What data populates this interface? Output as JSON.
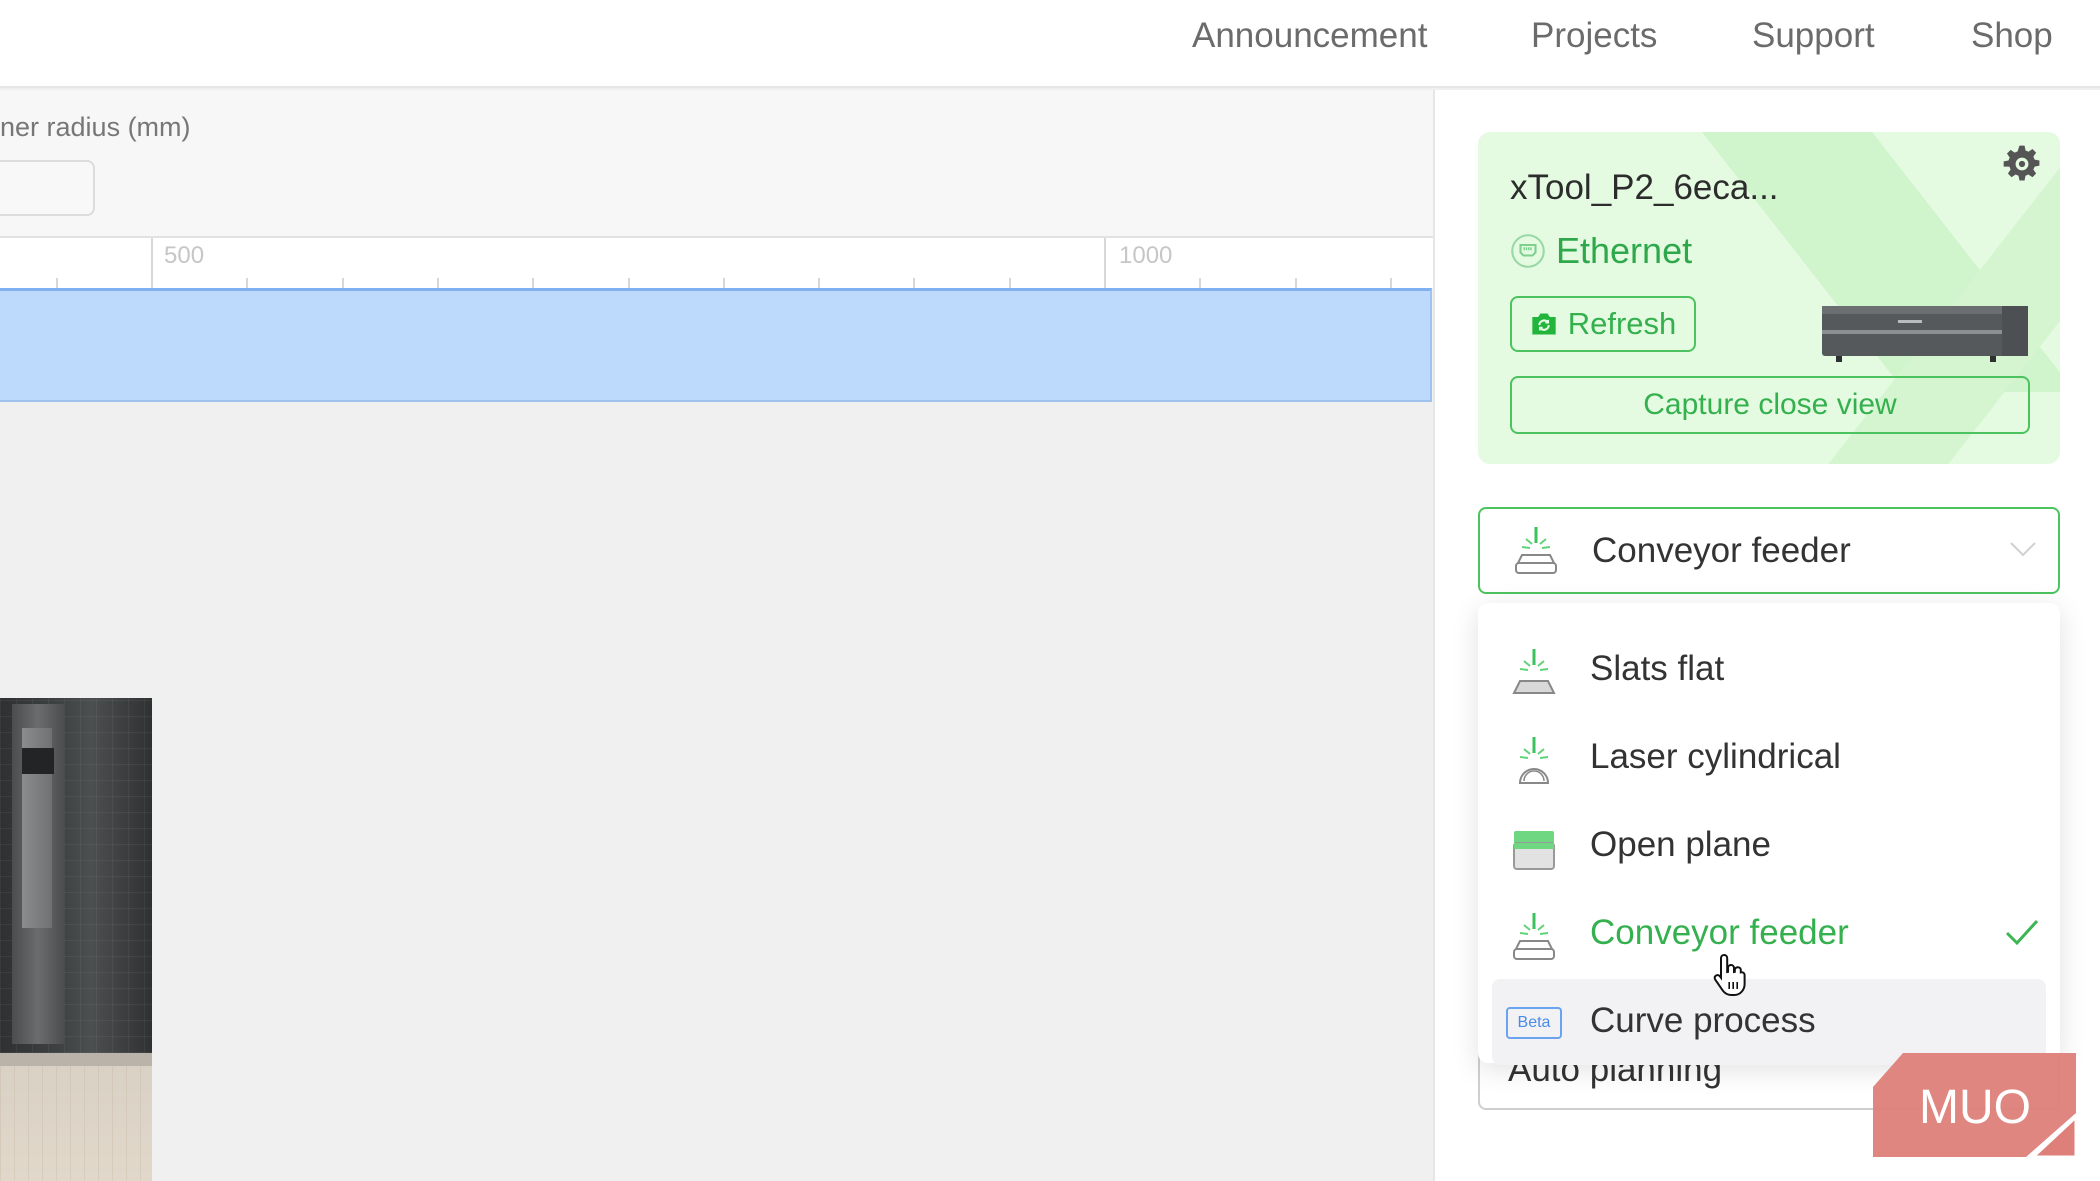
{
  "topnav": {
    "items": [
      "Announcement",
      "Projects",
      "Support",
      "Shop"
    ]
  },
  "props": {
    "label": "ner radius (mm)",
    "input_value": ""
  },
  "ruler": {
    "labels": [
      "500",
      "1000"
    ]
  },
  "device": {
    "name": "xTool_P2_6eca...",
    "connection": "Ethernet",
    "refresh_label": "Refresh",
    "capture_label": "Capture close view"
  },
  "mode_select": {
    "selected": "Conveyor feeder",
    "options": [
      {
        "label": "Slats flat",
        "icon": "slats-flat-icon"
      },
      {
        "label": "Laser cylindrical",
        "icon": "laser-cylindrical-icon"
      },
      {
        "label": "Open plane",
        "icon": "open-plane-icon"
      },
      {
        "label": "Conveyor feeder",
        "icon": "conveyor-feeder-icon",
        "selected": true
      },
      {
        "label": "Curve process",
        "icon": "beta-badge",
        "badge": "Beta"
      }
    ]
  },
  "behind_field": {
    "value": "Auto planning"
  },
  "watermark": {
    "text": "MUO"
  },
  "colors": {
    "accent_green": "#35b04e",
    "card_bg": "#e4fbe2",
    "selection_blue": "#bdd9fb",
    "beta_blue": "#4b8be8",
    "watermark_red": "#de7f7a"
  }
}
